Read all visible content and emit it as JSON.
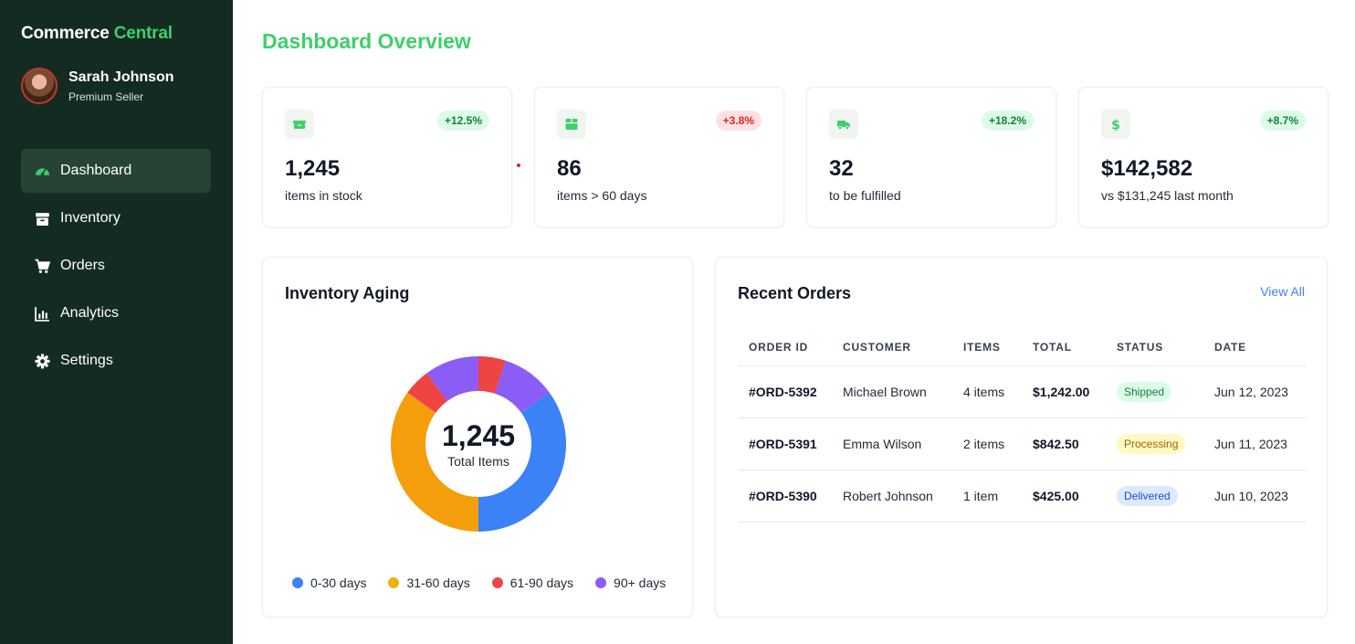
{
  "sidebar": {
    "brand_main": "Commerce",
    "brand_accent": "Central",
    "user": {
      "name": "Sarah Johnson",
      "role": "Premium Seller"
    },
    "items": [
      {
        "label": "Dashboard",
        "icon": "gauge-icon",
        "active": true
      },
      {
        "label": "Inventory",
        "icon": "box-icon"
      },
      {
        "label": "Orders",
        "icon": "cart-icon"
      },
      {
        "label": "Analytics",
        "icon": "chart-bar-icon"
      },
      {
        "label": "Settings",
        "icon": "gear-icon"
      }
    ]
  },
  "page_title": "Dashboard Overview",
  "stats": [
    {
      "value": "1,245",
      "label": "items in stock",
      "change": "+12.5%",
      "trend": "up",
      "icon": "boxes-icon"
    },
    {
      "value": "86",
      "label": "items > 60 days",
      "change": "+3.8%",
      "trend": "down",
      "icon": "box-icon"
    },
    {
      "value": "32",
      "label": "to be fulfilled",
      "change": "+18.2%",
      "trend": "up",
      "icon": "truck-icon"
    },
    {
      "value": "$142,582",
      "label": "vs $131,245 last month",
      "change": "+8.7%",
      "trend": "up",
      "icon": "dollar-icon"
    }
  ],
  "inventory_aging": {
    "title": "Inventory Aging",
    "center_value": "1,245",
    "center_label": "Total Items"
  },
  "chart_data": {
    "type": "pie",
    "categories": [
      "0-30 days",
      "31-60 days",
      "61-90 days",
      "90+ days"
    ],
    "values": [
      37,
      33,
      10,
      20
    ],
    "colors": [
      "#3b82f6",
      "#f59e0b",
      "#ef4444",
      "#8b5cf6"
    ],
    "segments_clockwise_from_top": [
      {
        "category": "61-90 days",
        "share": 5
      },
      {
        "category": "90+ days",
        "share": 10
      },
      {
        "category": "0-30 days",
        "share": 35
      },
      {
        "category": "31-60 days",
        "share": 35
      },
      {
        "category": "61-90 days",
        "share": 5
      },
      {
        "category": "90+ days",
        "share": 10
      }
    ],
    "center_total": "1,245",
    "legend_position": "bottom"
  },
  "recent_orders": {
    "title": "Recent Orders",
    "view_all": "View All",
    "columns": [
      "ORDER ID",
      "CUSTOMER",
      "ITEMS",
      "TOTAL",
      "STATUS",
      "DATE"
    ],
    "rows": [
      {
        "id": "#ORD-5392",
        "customer": "Michael Brown",
        "items": "4 items",
        "total": "$1,242.00",
        "status": "Shipped",
        "date": "Jun 12, 2023"
      },
      {
        "id": "#ORD-5391",
        "customer": "Emma Wilson",
        "items": "2 items",
        "total": "$842.50",
        "status": "Processing",
        "date": "Jun 11, 2023"
      },
      {
        "id": "#ORD-5390",
        "customer": "Robert Johnson",
        "items": "1 item",
        "total": "$425.00",
        "status": "Delivered",
        "date": "Jun 10, 2023"
      }
    ]
  },
  "colors": {
    "sidebar_bg": "#142b22",
    "accent_green": "#3ecf6a",
    "link_blue": "#3b82f6"
  }
}
